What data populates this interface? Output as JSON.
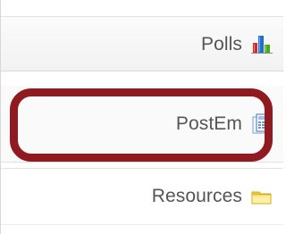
{
  "tool_menu": {
    "items": [
      {
        "label": "Polls",
        "icon": "polls-bar-chart-icon",
        "accent_colors": [
          "#1f6fd1",
          "#4ea81c",
          "#d12a2a"
        ]
      },
      {
        "label": "PostEm",
        "icon": "postem-grid-document-icon",
        "accent_colors": [
          "#3d72b8",
          "#9bc0ea",
          "#f4f8fd"
        ]
      },
      {
        "label": "Resources",
        "icon": "folder-icon",
        "accent_colors": [
          "#f1c545",
          "#fff1a6",
          "#d7ab21"
        ]
      }
    ],
    "highlight_color": "#8f1a1f"
  }
}
